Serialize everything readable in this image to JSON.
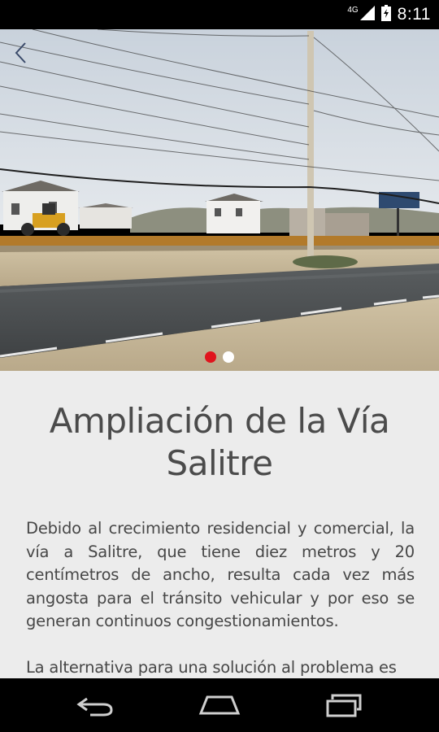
{
  "status_bar": {
    "network_type": "4G",
    "time": "8:11",
    "icons": [
      "signal-icon",
      "battery-icon"
    ]
  },
  "hero": {
    "image_subject": "road-under-construction-photo",
    "pager": {
      "count": 2,
      "active_index": 0
    },
    "colors": {
      "active_dot": "#e0141d",
      "inactive_dot": "#ffffff"
    }
  },
  "article": {
    "title": "Ampliación de la Vía Salitre",
    "paragraphs": [
      "Debido al crecimiento residencial y comercial, la vía a Salitre, que tiene diez metros y 20 centímetros de ancho, resulta cada vez más angosta para el tránsito vehicular y por eso se generan continuos congestionamientos.",
      "La alternativa para una solución al problema es"
    ]
  },
  "nav_bar": {
    "buttons": [
      "back-icon",
      "home-icon",
      "recent-apps-icon"
    ]
  }
}
